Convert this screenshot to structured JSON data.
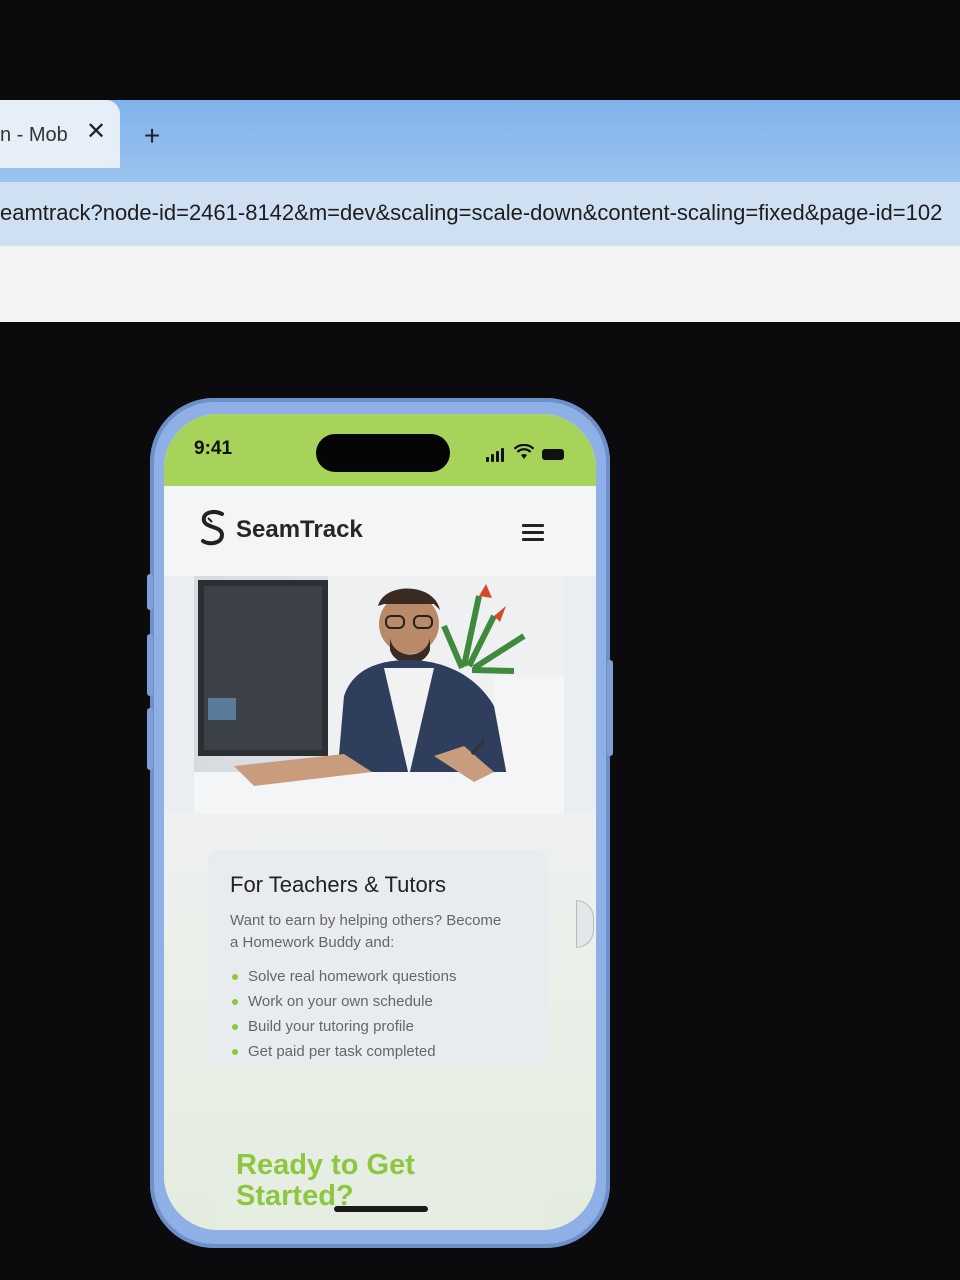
{
  "browser": {
    "tab_title": "n - Mob",
    "tab_close_symbol": "✕",
    "new_tab_symbol": "+",
    "url": "eamtrack?node-id=2461-8142&m=dev&scaling=scale-down&content-scaling=fixed&page-id=102"
  },
  "phone": {
    "status_time": "9:41",
    "brand_name": "SeamTrack",
    "statusbar_color": "#a8d35b",
    "accent_color": "#8dc63f",
    "hero_image": "man-writing-at-desk-photo"
  },
  "section": {
    "heading": "For Teachers & Tutors",
    "intro": "Want to earn by helping others? Become a Homework Buddy and:",
    "bullets": [
      "Solve real homework questions",
      "Work on your own schedule",
      "Build your tutoring profile",
      "Get paid per task completed"
    ]
  },
  "cta": {
    "title": "Ready to Get Started?"
  }
}
